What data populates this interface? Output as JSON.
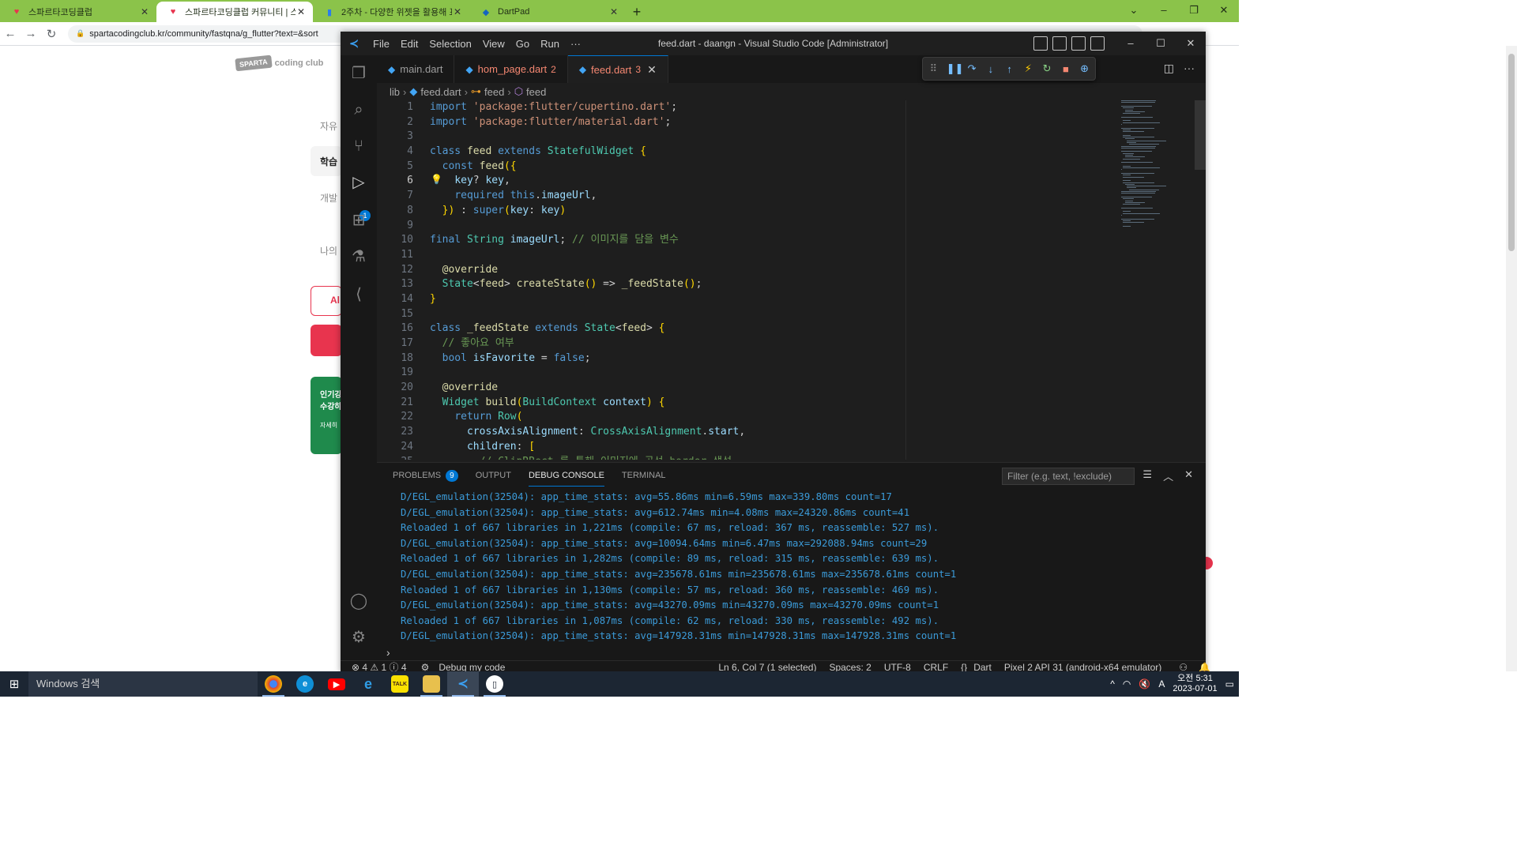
{
  "browser": {
    "tabs": [
      {
        "title": "스파르타코딩클럽",
        "active": false
      },
      {
        "title": "스파르타코딩클럽 커뮤니티 | 스",
        "active": true
      },
      {
        "title": "2주차 - 다양한 위젯을 활용해 표",
        "active": false
      },
      {
        "title": "DartPad",
        "active": false
      }
    ],
    "url": "spartacodingclub.kr/community/fastqna/g_flutter?text=&sort"
  },
  "site": {
    "logo_badge": "SPARTA",
    "logo_text": "coding club",
    "side_items": [
      "자유",
      "학습",
      "개발",
      "나의"
    ],
    "outline_btn": "Al",
    "green_card": [
      "인기강",
      "수강하",
      "자세히"
    ]
  },
  "vscode": {
    "window_title": "feed.dart - daangn - Visual Studio Code [Administrator]",
    "menu": [
      "File",
      "Edit",
      "Selection",
      "View",
      "Go",
      "Run",
      "···"
    ],
    "tabs": [
      {
        "name": "main.dart",
        "count": "",
        "active": false,
        "error": false
      },
      {
        "name": "hom_page.dart",
        "count": "2",
        "active": false,
        "error": true
      },
      {
        "name": "feed.dart",
        "count": "3",
        "active": true,
        "error": true
      }
    ],
    "breadcrumb": [
      "lib",
      "feed.dart",
      "feed",
      "feed"
    ],
    "code_lines": [
      "import 'package:flutter/cupertino.dart';",
      "import 'package:flutter/material.dart';",
      "",
      "class feed extends StatefulWidget {",
      "  const feed({",
      "    key? key,",
      "    required this.imageUrl,",
      "  }) : super(key: key)",
      "",
      "final String imageUrl; // 이미지를 담을 변수",
      "",
      "  @override",
      "  State<feed> createState() => _feedState();",
      "}",
      "",
      "class _feedState extends State<feed> {",
      "  // 좋아요 여부",
      "  bool isFavorite = false;",
      "",
      "  @override",
      "  Widget build(BuildContext context) {",
      "    return Row(",
      "      crossAxisAlignment: CrossAxisAlignment.start,",
      "      children: [",
      "        // ClipRRect 를 통해 이미지에 곡선 border 생성"
    ],
    "current_line": 6,
    "panel": {
      "tabs": [
        "PROBLEMS",
        "OUTPUT",
        "DEBUG CONSOLE",
        "TERMINAL"
      ],
      "problems_count": "9",
      "active_tab": "DEBUG CONSOLE",
      "filter_placeholder": "Filter (e.g. text, !exclude)",
      "console_lines": [
        "D/EGL_emulation(32504): app_time_stats: avg=55.86ms min=6.59ms max=339.80ms count=17",
        "D/EGL_emulation(32504): app_time_stats: avg=612.74ms min=4.08ms max=24320.86ms count=41",
        "Reloaded 1 of 667 libraries in 1,221ms (compile: 67 ms, reload: 367 ms, reassemble: 527 ms).",
        "D/EGL_emulation(32504): app_time_stats: avg=10094.64ms min=6.47ms max=292088.94ms count=29",
        "Reloaded 1 of 667 libraries in 1,282ms (compile: 89 ms, reload: 315 ms, reassemble: 639 ms).",
        "D/EGL_emulation(32504): app_time_stats: avg=235678.61ms min=235678.61ms max=235678.61ms count=1",
        "Reloaded 1 of 667 libraries in 1,130ms (compile: 57 ms, reload: 360 ms, reassemble: 469 ms).",
        "D/EGL_emulation(32504): app_time_stats: avg=43270.09ms min=43270.09ms max=43270.09ms count=1",
        "Reloaded 1 of 667 libraries in 1,087ms (compile: 62 ms, reload: 330 ms, reassemble: 492 ms).",
        "D/EGL_emulation(32504): app_time_stats: avg=147928.31ms min=147928.31ms max=147928.31ms count=1"
      ]
    },
    "status": {
      "errors": "4",
      "warnings": "1",
      "infos": "4",
      "debug": "Debug my code",
      "cursor": "Ln 6, Col 7 (1 selected)",
      "spaces": "Spaces: 2",
      "encoding": "UTF-8",
      "eol": "CRLF",
      "language": "Dart",
      "device": "Pixel 2 API 31 (android-x64 emulator)"
    }
  },
  "taskbar": {
    "search_placeholder": "Windows 검색",
    "time": "오전 5:31",
    "date": "2023-07-01",
    "ime": "A"
  },
  "colors": {
    "chrome_frame": "#8bc34a",
    "vscode_accent": "#0078d4",
    "console_text": "#3b9bd9",
    "brand_red": "#e8344e"
  }
}
